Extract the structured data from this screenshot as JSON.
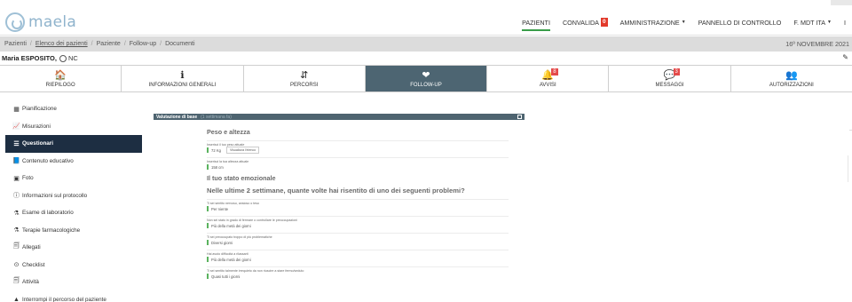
{
  "app": {
    "logo_text": "maela"
  },
  "topnav": [
    {
      "label": "PAZIENTI",
      "active": true
    },
    {
      "label": "CONVALIDA",
      "badge": "0"
    },
    {
      "label": "AMMINISTRAZIONE",
      "dropdown": true
    },
    {
      "label": "PANNELLO DI CONTROLLO"
    },
    {
      "label": "F. MDT ITA",
      "dropdown": true
    },
    {
      "label": "I"
    }
  ],
  "breadcrumb": {
    "items": [
      "Pazienti",
      "Elenco dei pazienti",
      "Paziente",
      "Follow-up",
      "Documenti"
    ],
    "date": "16º NOVEMBRE 2021"
  },
  "patient": {
    "name": "Maria ESPOSITO,",
    "suffix": "NC"
  },
  "tabs": [
    {
      "label": "RIEPILOGO",
      "icon": "home-icon",
      "glyph": "🏠"
    },
    {
      "label": "INFORMAZIONI GENERALI",
      "icon": "info-icon",
      "glyph": "ℹ"
    },
    {
      "label": "PERCORSI",
      "icon": "route-icon",
      "glyph": "⇵"
    },
    {
      "label": "FOLLOW-UP",
      "icon": "heartbeat-icon",
      "glyph": "❤",
      "active": true
    },
    {
      "label": "AVVISI",
      "icon": "bell-icon",
      "glyph": "🔔",
      "badge": "8"
    },
    {
      "label": "MESSAGGI",
      "icon": "chat-icon",
      "glyph": "💬",
      "badge": "3"
    },
    {
      "label": "AUTORIZZAZIONI",
      "icon": "users-icon",
      "glyph": "👥"
    }
  ],
  "sidemenu": [
    {
      "label": "Pianificazione",
      "icon": "calendar-icon",
      "glyph": "▦"
    },
    {
      "label": "Misurazioni",
      "icon": "chart-icon",
      "glyph": "📈"
    },
    {
      "label": "Questionari",
      "icon": "questionnaire-icon",
      "glyph": "☰",
      "active": true
    },
    {
      "label": "Contenuto educativo",
      "icon": "book-icon",
      "glyph": "📘"
    },
    {
      "label": "Foto",
      "icon": "image-icon",
      "glyph": "▣"
    },
    {
      "label": "Informazioni sul protocollo",
      "icon": "info-circle-icon",
      "glyph": "ⓘ"
    },
    {
      "label": "Esame di laboratorio",
      "icon": "flask-icon",
      "glyph": "⚗"
    },
    {
      "label": "Terapie farmacologiche",
      "icon": "flask-icon",
      "glyph": "⚗"
    },
    {
      "label": "Allegati",
      "icon": "paperclip-icon",
      "glyph": "🗐"
    },
    {
      "label": "Checklist",
      "icon": "check-circle-icon",
      "glyph": "⊙"
    },
    {
      "label": "Attività",
      "icon": "activity-icon",
      "glyph": "🗐"
    },
    {
      "label": "Interrompi il percorso del paziente",
      "icon": "warning-icon",
      "glyph": "▲"
    }
  ],
  "panel": {
    "title": "Valutazione di base",
    "subtitle": "(1 settimana fa)",
    "sections": [
      {
        "heading": "Peso e altezza",
        "questions": [
          {
            "label": "Inserisci il tuo peso attuale",
            "value": "72 Kg",
            "button": "Visualizza l'elenco"
          },
          {
            "label": "Inserisci la tua altezza attuale",
            "value": "158 cm"
          }
        ]
      },
      {
        "heading": "Il tuo stato emozionale",
        "questions": []
      },
      {
        "heading": "Nelle ultime 2 settimane, quante volte hai risentito di uno dei seguenti problemi?",
        "questions": [
          {
            "label": "Ti sei sentito nervoso, ansioso o teso",
            "value": "Per niente"
          },
          {
            "label": "Non sei stato in grado di fermare o controllare le preoccupazioni",
            "value": "Più della metà dei giorni"
          },
          {
            "label": "Ti sei preoccupato troppo di più problematiche",
            "value": "Diversi giorni"
          },
          {
            "label": "Hai avuto difficoltà a rilassarti",
            "value": "Più della metà dei giorni"
          },
          {
            "label": "Ti sei sentito talmente irrequieto da non riuscire a stare fermo/seduto",
            "value": "Quasi tutti i giorni"
          }
        ]
      }
    ]
  },
  "colors": {
    "accent": "#3a9d4a",
    "active_tab": "#4d6572",
    "sidebar_active": "#1d2e42",
    "badge": "#e23a2b"
  }
}
